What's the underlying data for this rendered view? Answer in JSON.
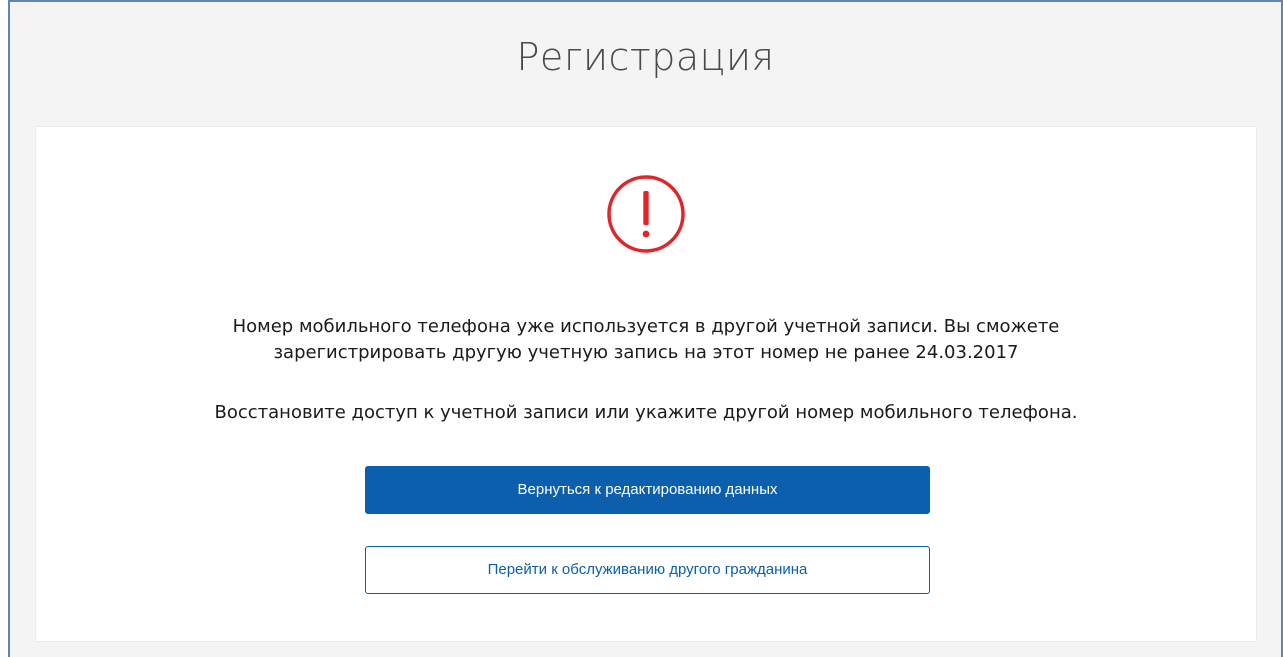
{
  "page": {
    "title": "Регистрация"
  },
  "alert": {
    "icon": "exclamation-circle-icon",
    "color": "#e0262b",
    "message_lines": [
      "Номер мобильного телефона уже используется в другой учетной записи. Вы сможете",
      "зарегистрировать другую учетную запись на этот номер не ранее 24.03.2017"
    ],
    "hint": "Восстановите доступ к учетной записи или укажите другой номер мобильного телефона."
  },
  "actions": {
    "primary_label": "Вернуться к редактированию данных",
    "secondary_label": "Перейти к обслуживанию другого гражданина"
  },
  "colors": {
    "accent": "#0b5fad",
    "frame_border": "#5d86b6",
    "background": "#f4f4f4"
  }
}
